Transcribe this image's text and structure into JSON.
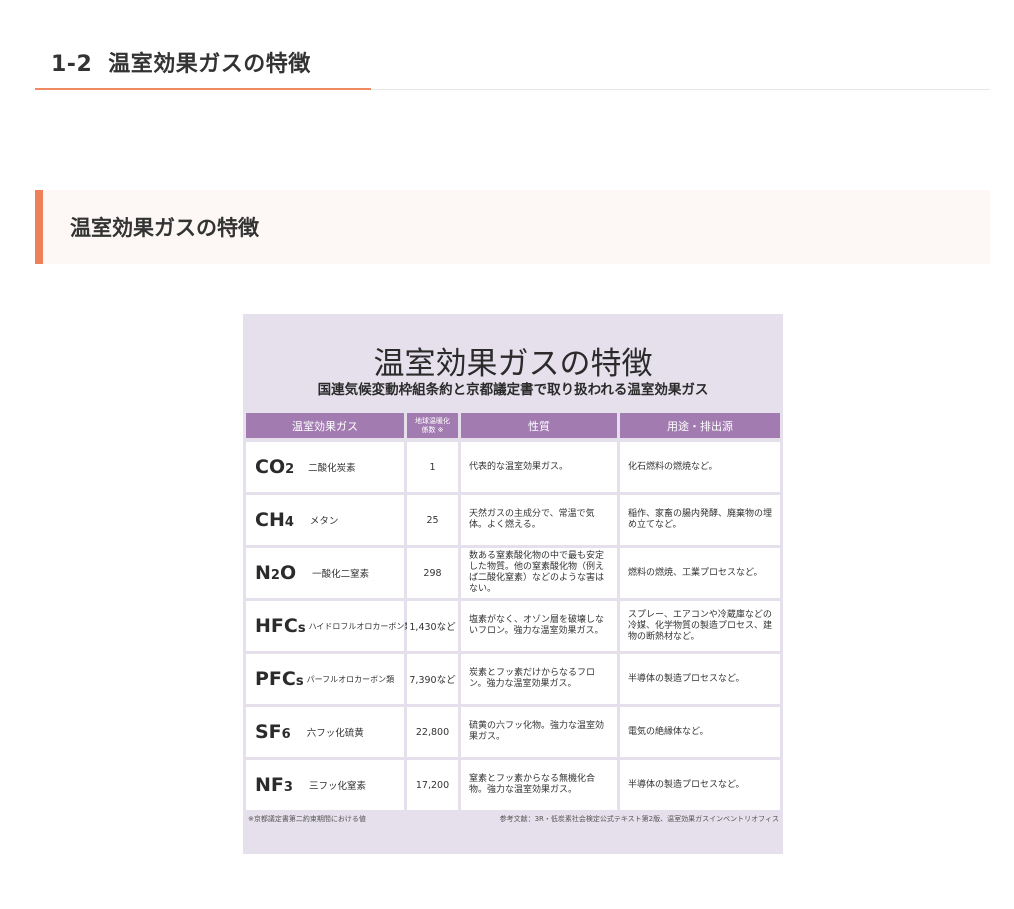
{
  "page": {
    "section_number": "1-2",
    "section_title": "温室効果ガスの特徴",
    "subheading": "温室効果ガスの特徴"
  },
  "colors": {
    "accent": "#ef8a62",
    "header_bar": "#a27bb1",
    "figure_bg": "#e5e0ec",
    "subheading_bg": "#fdf8f6"
  },
  "figure": {
    "title": "温室効果ガスの特徴",
    "subtitle": "国連気候変動枠組条約と京都議定書で取り扱われる温室効果ガス",
    "headers": {
      "gas": "温室効果ガス",
      "gwp_line1": "地球温暖化",
      "gwp_line2": "係数 ※",
      "property": "性質",
      "usage": "用途・排出源"
    },
    "rows": [
      {
        "formula_main": "CO",
        "formula_sub": "2",
        "name": "二酸化炭素",
        "gwp": "1",
        "property": "代表的な温室効果ガス。",
        "usage": "化石燃料の燃焼など。"
      },
      {
        "formula_main": "CH",
        "formula_sub": "4",
        "name": "メタン",
        "gwp": "25",
        "property": "天然ガスの主成分で、常温で気体。よく燃える。",
        "usage": "稲作、家畜の腸内発酵、廃棄物の埋め立てなど。"
      },
      {
        "formula_main": "N",
        "formula_sub": "2",
        "formula_tail": "O",
        "name": "一酸化二窒素",
        "gwp": "298",
        "property": "数ある窒素酸化物の中で最も安定した物質。他の窒素酸化物（例えば二酸化窒素）などのような害はない。",
        "usage": "燃料の燃焼、工業プロセスなど。"
      },
      {
        "formula_main": "HFC",
        "formula_sub": "s",
        "name": "ハイドロフルオロカーボン類",
        "gwp": "1,430など",
        "property": "塩素がなく、オゾン層を破壊しないフロン。強力な温室効果ガス。",
        "usage": "スプレー、エアコンや冷蔵庫などの冷媒、化学物質の製造プロセス、建物の断熱材など。"
      },
      {
        "formula_main": "PFC",
        "formula_sub": "s",
        "name": "パーフルオロカーボン類",
        "gwp": "7,390など",
        "property": "炭素とフッ素だけからなるフロン。強力な温室効果ガス。",
        "usage": "半導体の製造プロセスなど。"
      },
      {
        "formula_main": "SF",
        "formula_sub": "6",
        "name": "六フッ化硫黄",
        "gwp": "22,800",
        "property": "硫黄の六フッ化物。強力な温室効果ガス。",
        "usage": "電気の絶縁体など。"
      },
      {
        "formula_main": "NF",
        "formula_sub": "3",
        "name": "三フッ化窒素",
        "gwp": "17,200",
        "property": "窒素とフッ素からなる無機化合物。強力な温室効果ガス。",
        "usage": "半導体の製造プロセスなど。"
      }
    ],
    "footnote": "※京都議定書第二約束期間における値",
    "reference": "参考文献：3R・低炭素社会検定公式テキスト第2版、温室効果ガスインベントリオフィス"
  }
}
